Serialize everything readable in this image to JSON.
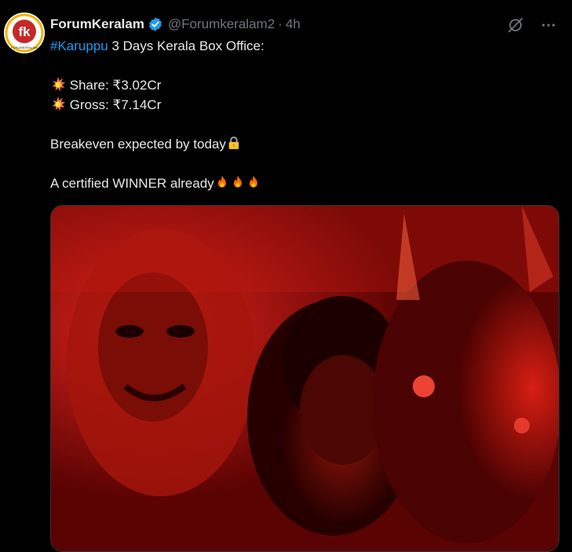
{
  "author": {
    "name": "ForumKeralam",
    "handle": "@Forumkeralam2",
    "separator": "·",
    "time": "4h",
    "avatar_text": "fk",
    "avatar_subtext": "FORUMKERALAM"
  },
  "tweet": {
    "hashtag": "#Karuppu",
    "headline_rest": " 3 Days Kerala Box Office:",
    "share": "Share: ₹3.02Cr",
    "gross": "Gross: ₹7.14Cr",
    "breakeven": "Breakeven expected by today",
    "winner": "A certified WINNER already"
  },
  "icons": {
    "collision": "collision-icon",
    "lock": "lock-icon",
    "fire": "fire-icon",
    "grok": "grok-icon",
    "more": "more-icon",
    "verified": "verified-badge-icon"
  },
  "colors": {
    "background": "#000000",
    "text": "#e7e9ea",
    "muted": "#71767b",
    "link": "#1d9bf0",
    "image_tint": "#b10f0a"
  }
}
